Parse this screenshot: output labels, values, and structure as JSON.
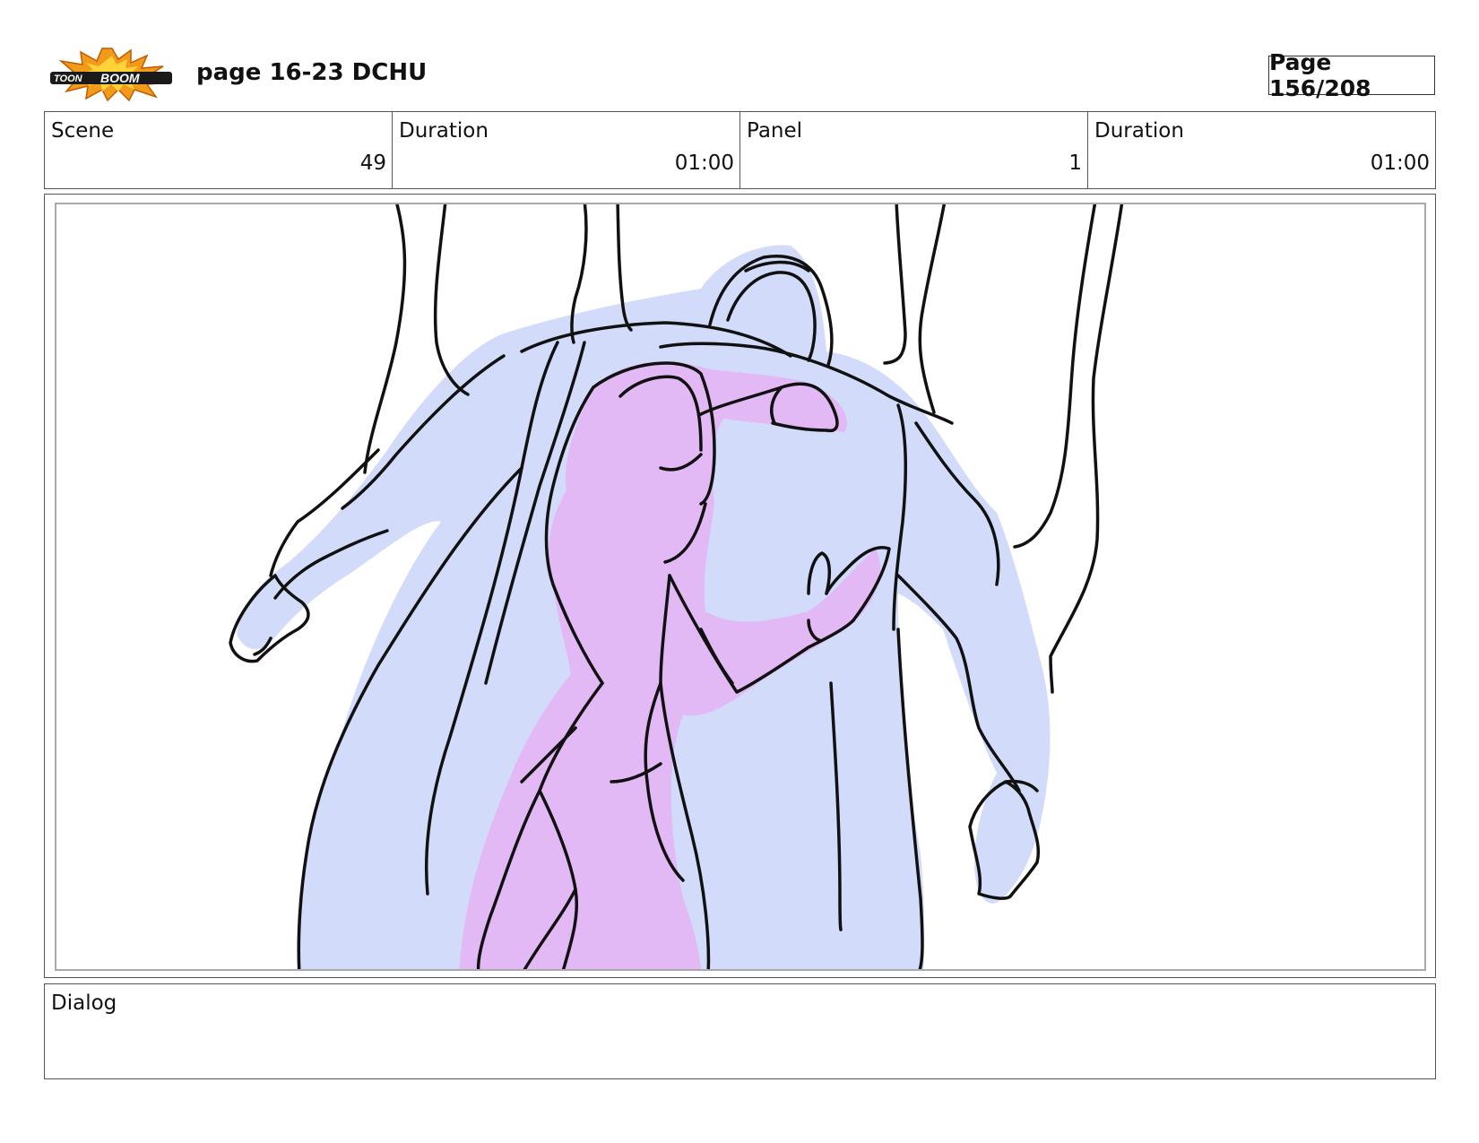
{
  "header": {
    "logo_text": [
      "TOON",
      "BOOM"
    ],
    "title": "page 16-23 DCHU",
    "page_indicator": "Page 156/208"
  },
  "info": {
    "scene_label": "Scene",
    "scene_value": "49",
    "scene_duration_label": "Duration",
    "scene_duration_value": "01:00",
    "panel_label": "Panel",
    "panel_value": "1",
    "panel_duration_label": "Duration",
    "panel_duration_value": "01:00"
  },
  "panel": {
    "description": "",
    "fill_colors": {
      "hero": "#d2dcfa",
      "woman": "#e2b8f5",
      "line": "#111111"
    }
  },
  "dialog": {
    "label": "Dialog",
    "text": ""
  }
}
